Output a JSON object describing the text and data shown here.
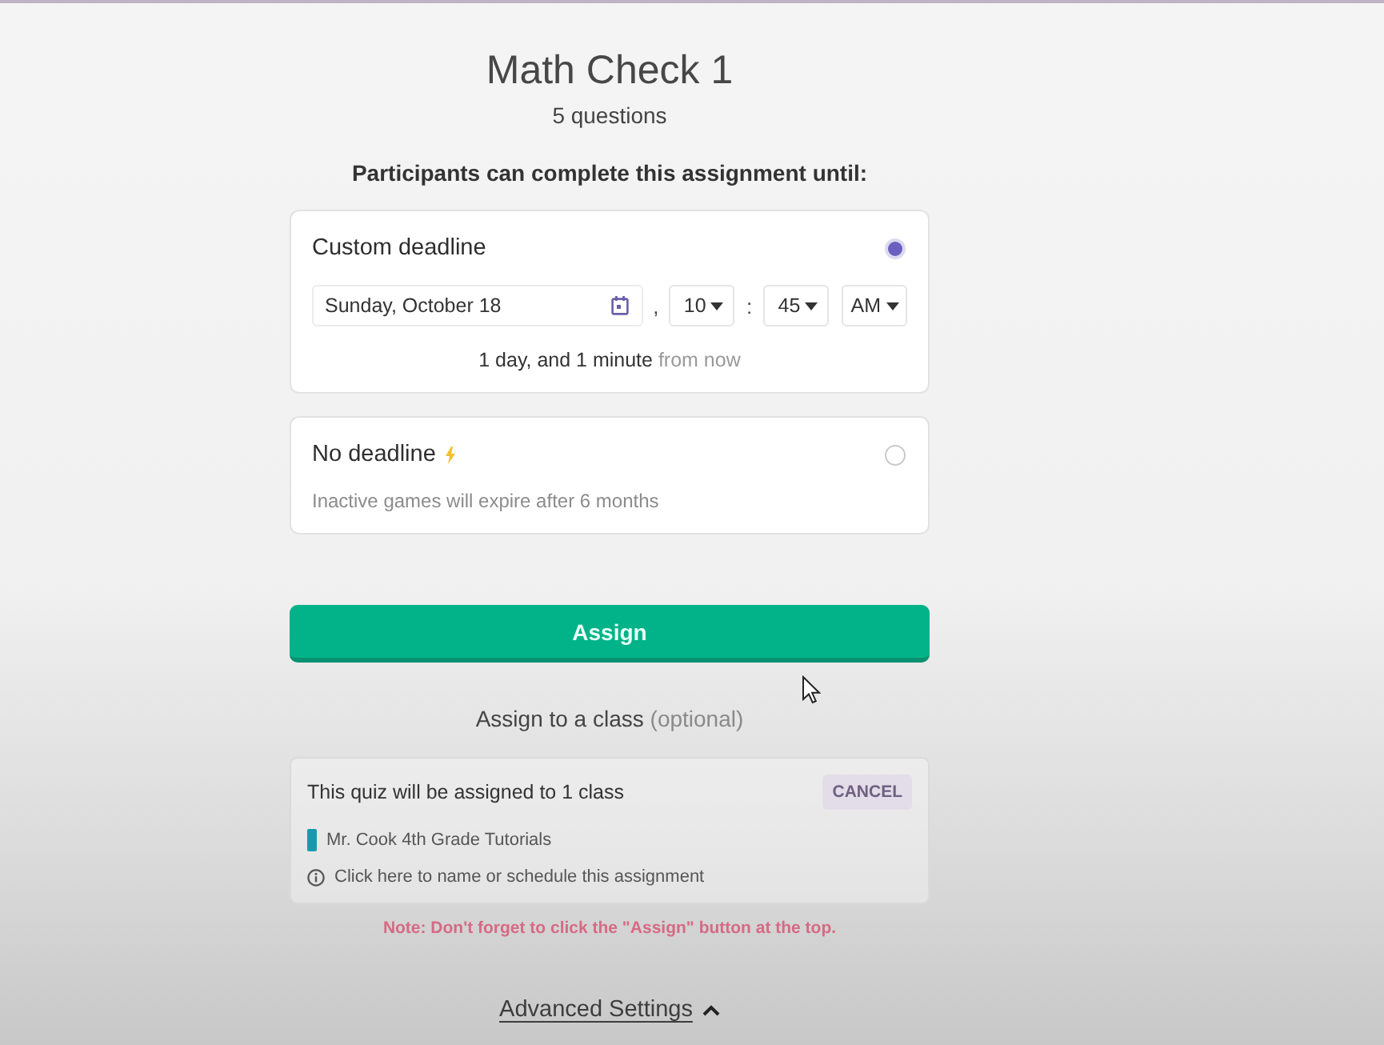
{
  "header": {
    "title": "Math Check 1",
    "subtitle": "5 questions"
  },
  "deadline_prompt": "Participants can complete this assignment until:",
  "deadline_options": [
    {
      "kind": "custom",
      "label": "Custom deadline",
      "selected": true,
      "date": "Sunday, October 18",
      "date_separator": ",",
      "hour": "10",
      "time_separator": ":",
      "minute": "45",
      "period": "AM",
      "summary": "**1 day, and 1 minute** from now"
    },
    {
      "kind": "none",
      "label": "No deadline",
      "selected": false,
      "note": "Inactive games will expire after 6 months"
    }
  ],
  "assign_button": "Assign",
  "class_section": {
    "heading": "**Assign to a class** (optional)",
    "card_title": "This quiz will be assigned to 1 class",
    "cancel_button": "CANCEL",
    "classes": [
      {
        "name": "Mr. Cook 4th Grade Tutorials",
        "color": "#1a98ae"
      }
    ],
    "schedule_link": "Click here to name or schedule this assignment",
    "note": "Note: Don't forget to click the \"Assign\" button at the top."
  },
  "advanced_settings": {
    "label": "Advanced Settings",
    "expanded": true
  }
}
